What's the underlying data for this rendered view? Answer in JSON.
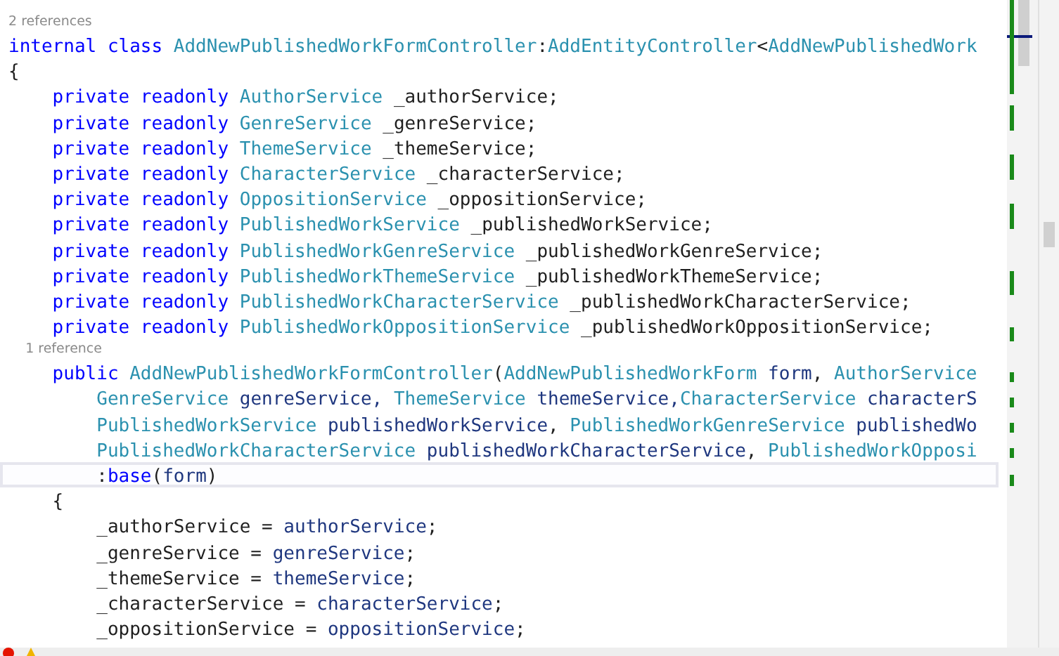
{
  "editor": {
    "lines": [
      {
        "kind": "codelens",
        "text": "2 references"
      },
      {
        "kind": "code",
        "current": false,
        "tokens": [
          {
            "kind": "kw",
            "text": "internal class "
          },
          {
            "kind": "type",
            "text": "AddNewPublishedWorkFormController"
          },
          {
            "kind": "text",
            "text": ":"
          },
          {
            "kind": "type",
            "text": "AddEntityController"
          },
          {
            "kind": "text",
            "text": "<"
          },
          {
            "kind": "type",
            "text": "AddNewPublishedWork"
          }
        ]
      },
      {
        "kind": "code",
        "current": false,
        "tokens": [
          {
            "kind": "text",
            "text": "{"
          }
        ]
      },
      {
        "kind": "code",
        "current": false,
        "tokens": [
          {
            "kind": "kw",
            "text": "    private readonly "
          },
          {
            "kind": "type",
            "text": "AuthorService"
          },
          {
            "kind": "text",
            "text": " _authorService;"
          }
        ]
      },
      {
        "kind": "code",
        "current": false,
        "tokens": [
          {
            "kind": "kw",
            "text": "    private readonly "
          },
          {
            "kind": "type",
            "text": "GenreService"
          },
          {
            "kind": "text",
            "text": " _genreService;"
          }
        ]
      },
      {
        "kind": "code",
        "current": false,
        "tokens": [
          {
            "kind": "kw",
            "text": "    private readonly "
          },
          {
            "kind": "type",
            "text": "ThemeService"
          },
          {
            "kind": "text",
            "text": " _themeService;"
          }
        ]
      },
      {
        "kind": "code",
        "current": false,
        "tokens": [
          {
            "kind": "kw",
            "text": "    private readonly "
          },
          {
            "kind": "type",
            "text": "CharacterService"
          },
          {
            "kind": "text",
            "text": " _characterService;"
          }
        ]
      },
      {
        "kind": "code",
        "current": false,
        "tokens": [
          {
            "kind": "kw",
            "text": "    private readonly "
          },
          {
            "kind": "type",
            "text": "OppositionService"
          },
          {
            "kind": "text",
            "text": " _oppositionService;"
          }
        ]
      },
      {
        "kind": "code",
        "current": false,
        "tokens": [
          {
            "kind": "kw",
            "text": "    private readonly "
          },
          {
            "kind": "type",
            "text": "PublishedWorkService"
          },
          {
            "kind": "text",
            "text": " _publishedWorkService;"
          }
        ]
      },
      {
        "kind": "code",
        "current": false,
        "tokens": [
          {
            "kind": "kw",
            "text": "    private readonly "
          },
          {
            "kind": "type",
            "text": "PublishedWorkGenreService"
          },
          {
            "kind": "text",
            "text": " _publishedWorkGenreService;"
          }
        ]
      },
      {
        "kind": "code",
        "current": false,
        "tokens": [
          {
            "kind": "kw",
            "text": "    private readonly "
          },
          {
            "kind": "type",
            "text": "PublishedWorkThemeService"
          },
          {
            "kind": "text",
            "text": " _publishedWorkThemeService;"
          }
        ]
      },
      {
        "kind": "code",
        "current": false,
        "tokens": [
          {
            "kind": "kw",
            "text": "    private readonly "
          },
          {
            "kind": "type",
            "text": "PublishedWorkCharacterService"
          },
          {
            "kind": "text",
            "text": " _publishedWorkCharacterService;"
          }
        ]
      },
      {
        "kind": "code",
        "current": false,
        "tokens": [
          {
            "kind": "kw",
            "text": "    private readonly "
          },
          {
            "kind": "type",
            "text": "PublishedWorkOppositionService"
          },
          {
            "kind": "text",
            "text": " _publishedWorkOppositionService;"
          }
        ]
      },
      {
        "kind": "codelens",
        "text": "    1 reference"
      },
      {
        "kind": "code",
        "current": false,
        "tokens": [
          {
            "kind": "kw",
            "text": "    public "
          },
          {
            "kind": "type",
            "text": "AddNewPublishedWorkFormController"
          },
          {
            "kind": "text",
            "text": "("
          },
          {
            "kind": "type",
            "text": "AddNewPublishedWorkForm"
          },
          {
            "kind": "param",
            "text": " form"
          },
          {
            "kind": "text",
            "text": ","
          },
          {
            "kind": "type",
            "text": " AuthorService"
          }
        ]
      },
      {
        "kind": "code",
        "current": false,
        "tokens": [
          {
            "kind": "type",
            "text": "        GenreService"
          },
          {
            "kind": "param",
            "text": " genreService,"
          },
          {
            "kind": "type",
            "text": " ThemeService"
          },
          {
            "kind": "param",
            "text": " themeService,"
          },
          {
            "kind": "type",
            "text": "CharacterService"
          },
          {
            "kind": "param",
            "text": " characterS"
          }
        ]
      },
      {
        "kind": "code",
        "current": false,
        "tokens": [
          {
            "kind": "type",
            "text": "        PublishedWorkService"
          },
          {
            "kind": "param",
            "text": " publishedWorkService"
          },
          {
            "kind": "text",
            "text": ","
          },
          {
            "kind": "type",
            "text": " PublishedWorkGenreService"
          },
          {
            "kind": "param",
            "text": " publishedWo"
          }
        ]
      },
      {
        "kind": "code",
        "current": false,
        "tokens": [
          {
            "kind": "type",
            "text": "        PublishedWorkCharacterService"
          },
          {
            "kind": "param",
            "text": " publishedWorkCharacterService"
          },
          {
            "kind": "text",
            "text": ","
          },
          {
            "kind": "type",
            "text": " PublishedWorkOpposi"
          }
        ]
      },
      {
        "kind": "code",
        "current": true,
        "tokens": [
          {
            "kind": "text",
            "text": "        :"
          },
          {
            "kind": "kw",
            "text": "base"
          },
          {
            "kind": "text",
            "text": "("
          },
          {
            "kind": "param",
            "text": "form"
          },
          {
            "kind": "text",
            "text": ")"
          }
        ]
      },
      {
        "kind": "code",
        "current": false,
        "tokens": [
          {
            "kind": "text",
            "text": "    {"
          }
        ]
      },
      {
        "kind": "code",
        "current": false,
        "tokens": [
          {
            "kind": "text",
            "text": "        _authorService = "
          },
          {
            "kind": "param",
            "text": "authorService"
          },
          {
            "kind": "text",
            "text": ";"
          }
        ]
      },
      {
        "kind": "code",
        "current": false,
        "tokens": [
          {
            "kind": "text",
            "text": "        _genreService = "
          },
          {
            "kind": "param",
            "text": "genreService"
          },
          {
            "kind": "text",
            "text": ";"
          }
        ]
      },
      {
        "kind": "code",
        "current": false,
        "tokens": [
          {
            "kind": "text",
            "text": "        _themeService = "
          },
          {
            "kind": "param",
            "text": "themeService"
          },
          {
            "kind": "text",
            "text": ";"
          }
        ]
      },
      {
        "kind": "code",
        "current": false,
        "tokens": [
          {
            "kind": "text",
            "text": "        _characterService = "
          },
          {
            "kind": "param",
            "text": "characterService"
          },
          {
            "kind": "text",
            "text": ";"
          }
        ]
      },
      {
        "kind": "code",
        "current": false,
        "tokens": [
          {
            "kind": "text",
            "text": "        _oppositionService = "
          },
          {
            "kind": "param",
            "text": "oppositionService"
          },
          {
            "kind": "text",
            "text": ";"
          }
        ]
      }
    ]
  }
}
